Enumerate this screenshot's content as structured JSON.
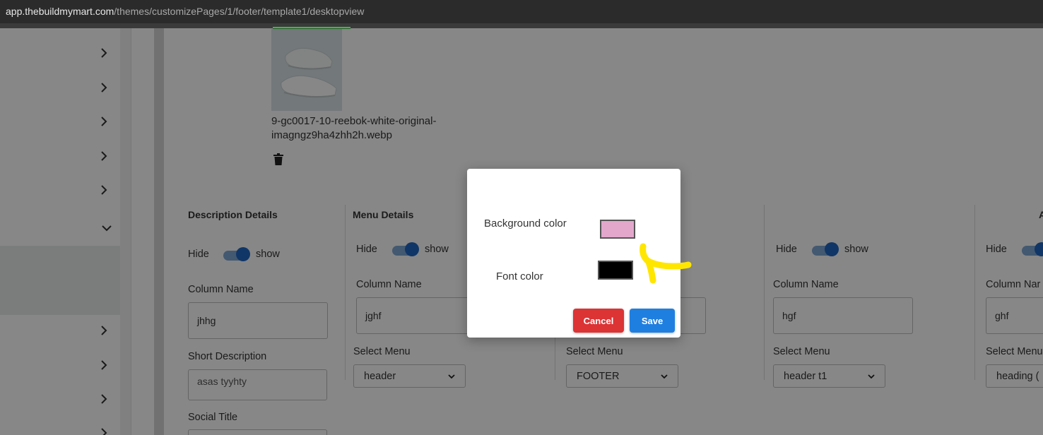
{
  "browser": {
    "url_host": "app.thebuildmymart.com",
    "url_path": "/themes/customizePages/1/footer/template1/desktopview"
  },
  "media": {
    "file_name_line1": "9-gc0017-10-reebok-white-original-",
    "file_name_line2": "imagngz9ha4zhh2h.webp"
  },
  "sections": {
    "description_title": "Description Details",
    "menu_title": "Menu Details",
    "partial_title": "A"
  },
  "columns": [
    {
      "hide_label": "Hide",
      "show_label": "show",
      "column_name_label": "Column Name",
      "column_name_value": "jhhg",
      "short_description_label": "Short Description",
      "short_description_value": "asas tyyhty",
      "social_title_label": "Social Title"
    },
    {
      "hide_label": "Hide",
      "show_label": "show",
      "column_name_label": "Column Name",
      "column_name_value": "jghf",
      "select_menu_label": "Select Menu",
      "select_menu_value": "header"
    },
    {
      "select_menu_label": "Select Menu",
      "select_menu_value": "FOOTER"
    },
    {
      "hide_label": "Hide",
      "show_label": "show",
      "column_name_label": "Column Name",
      "column_name_value": "hgf",
      "select_menu_label": "Select Menu",
      "select_menu_value": "header t1"
    },
    {
      "hide_label": "Hide",
      "column_name_label": "Column Nar",
      "column_name_value": "ghf",
      "select_menu_label": "Select Menu",
      "select_menu_value": "heading ("
    }
  ],
  "modal": {
    "background_color_label": "Background color",
    "background_color_value": "#e3a7cc",
    "font_color_label": "Font color",
    "font_color_value": "#000000",
    "cancel_label": "Cancel",
    "save_label": "Save"
  },
  "colors": {
    "cancel_button": "#dc3335",
    "save_button": "#1f7fe0",
    "annotation": "#ffe600",
    "toggle_on": "#1f66c2"
  },
  "icons": [
    "chevron-right-icon",
    "chevron-down-icon",
    "trash-icon",
    "dropdown-caret-icon"
  ]
}
